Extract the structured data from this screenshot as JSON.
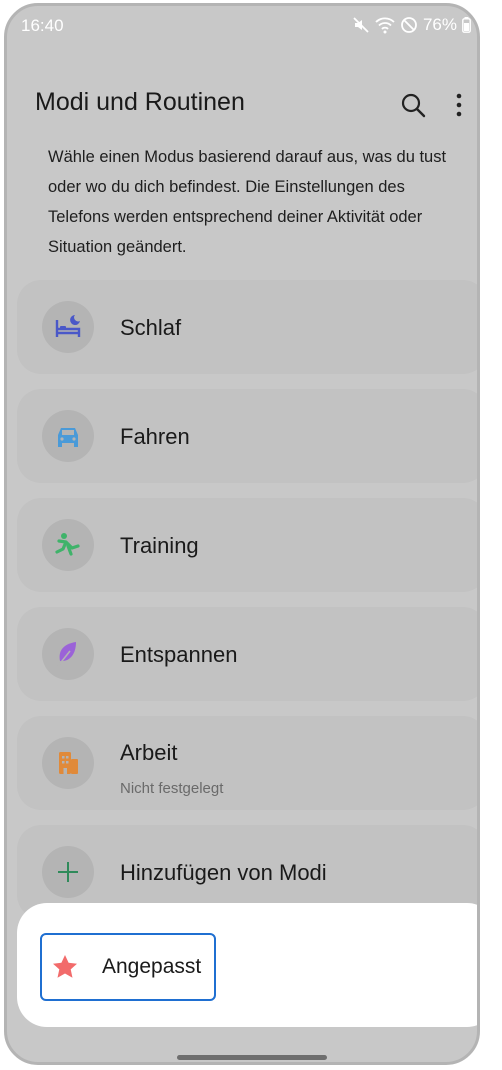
{
  "status_bar": {
    "time": "16:40",
    "battery": "76%",
    "icons": [
      "mute-icon",
      "wifi-icon",
      "do-not-disturb-icon",
      "battery-icon"
    ]
  },
  "header": {
    "title": "Modi und Routinen",
    "search_icon": "search-icon",
    "more_icon": "more-options-icon"
  },
  "description": "Wähle einen Modus basierend darauf aus, was du tust oder wo du dich befindest. Die Einstellungen des Telefons werden entsprechend deiner Aktivität oder Situation geändert.",
  "modes": [
    {
      "label": "Schlaf",
      "icon": "sleep-icon",
      "color": "#4a58c8"
    },
    {
      "label": "Fahren",
      "icon": "car-icon",
      "color": "#4a9ad8"
    },
    {
      "label": "Training",
      "icon": "exercise-icon",
      "color": "#3fb36a"
    },
    {
      "label": "Entspannen",
      "icon": "leaf-icon",
      "color": "#9b63d8"
    },
    {
      "label": "Arbeit",
      "sublabel": "Nicht festgelegt",
      "icon": "building-icon",
      "color": "#e08a3a"
    },
    {
      "label": "Hinzufügen von Modi",
      "icon": "plus-icon",
      "color": "#2f8a5a"
    }
  ],
  "bottom_sheet": {
    "button_label": "Angepasst",
    "icon": "star-icon",
    "icon_color": "#f26b6b",
    "highlight_color": "#1f6fd1"
  }
}
